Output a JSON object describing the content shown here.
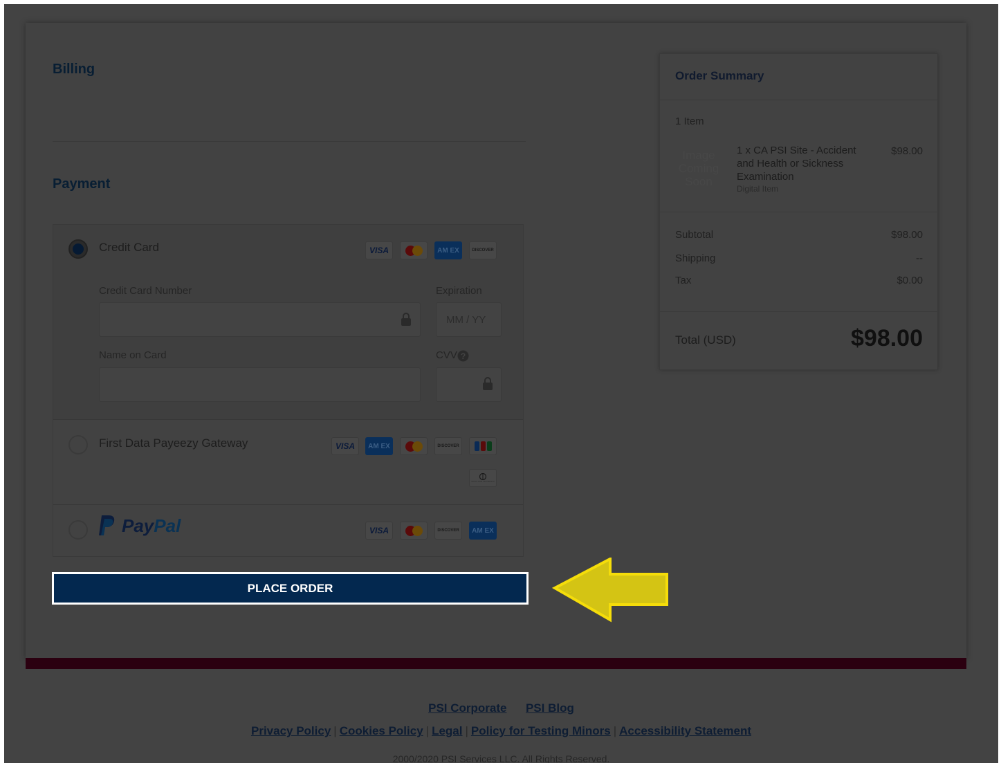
{
  "billing": {
    "title": "Billing"
  },
  "payment": {
    "title": "Payment",
    "methods": [
      {
        "label": "Credit Card",
        "selected": true,
        "card_icons": [
          "visa-icon",
          "mastercard-icon",
          "amex-icon",
          "discover-icon"
        ]
      },
      {
        "label": "First Data Payeezy Gateway",
        "selected": false,
        "card_icons": [
          "visa-icon",
          "amex-icon",
          "mastercard-icon",
          "discover-icon",
          "jcb-icon",
          "diners-club-icon"
        ]
      },
      {
        "label": "PayPal",
        "selected": false,
        "card_icons": [
          "visa-icon",
          "mastercard-icon",
          "discover-icon",
          "amex-icon"
        ]
      }
    ],
    "paypal_logo": {
      "pay": "Pay",
      "pal": "Pal"
    },
    "card_labels": {
      "visa": "VISA",
      "amex": "AM EX",
      "discover": "DISCOVER",
      "diners": "Diners Club International"
    },
    "fields": {
      "card_number_label": "Credit Card Number",
      "card_number_value": "",
      "expiration_label": "Expiration",
      "expiration_placeholder": "MM / YY",
      "name_label": "Name on Card",
      "name_value": "",
      "cvv_label": "CVV",
      "cvv_value": ""
    }
  },
  "place_order": {
    "label": "PLACE ORDER"
  },
  "order_summary": {
    "title": "Order Summary",
    "item_count": "1 Item",
    "image_placeholder": "Image Coming Soon",
    "item": {
      "name": "1 x CA PSI Site - Accident and Health or Sickness Examination",
      "type": "Digital Item",
      "price": "$98.00"
    },
    "subtotal_label": "Subtotal",
    "subtotal_value": "$98.00",
    "shipping_label": "Shipping",
    "shipping_value": "--",
    "tax_label": "Tax",
    "tax_value": "$0.00",
    "total_label": "Total (USD)",
    "total_value": "$98.00"
  },
  "footer": {
    "links_row1": [
      "PSI Corporate",
      "PSI Blog"
    ],
    "links_row2": [
      "Privacy Policy",
      "Cookies Policy",
      "Legal",
      "Policy for Testing Minors",
      "Accessibility Statement"
    ],
    "separator": "|",
    "copyright": "2000/2020 PSI Services LLC. All Rights Reserved."
  },
  "colors": {
    "overlay": "#434343",
    "brand_navy": "#03284f",
    "footer_bar": "#2b0010",
    "arrow_fill": "#d4c414",
    "arrow_stroke": "#f5dd0a"
  }
}
